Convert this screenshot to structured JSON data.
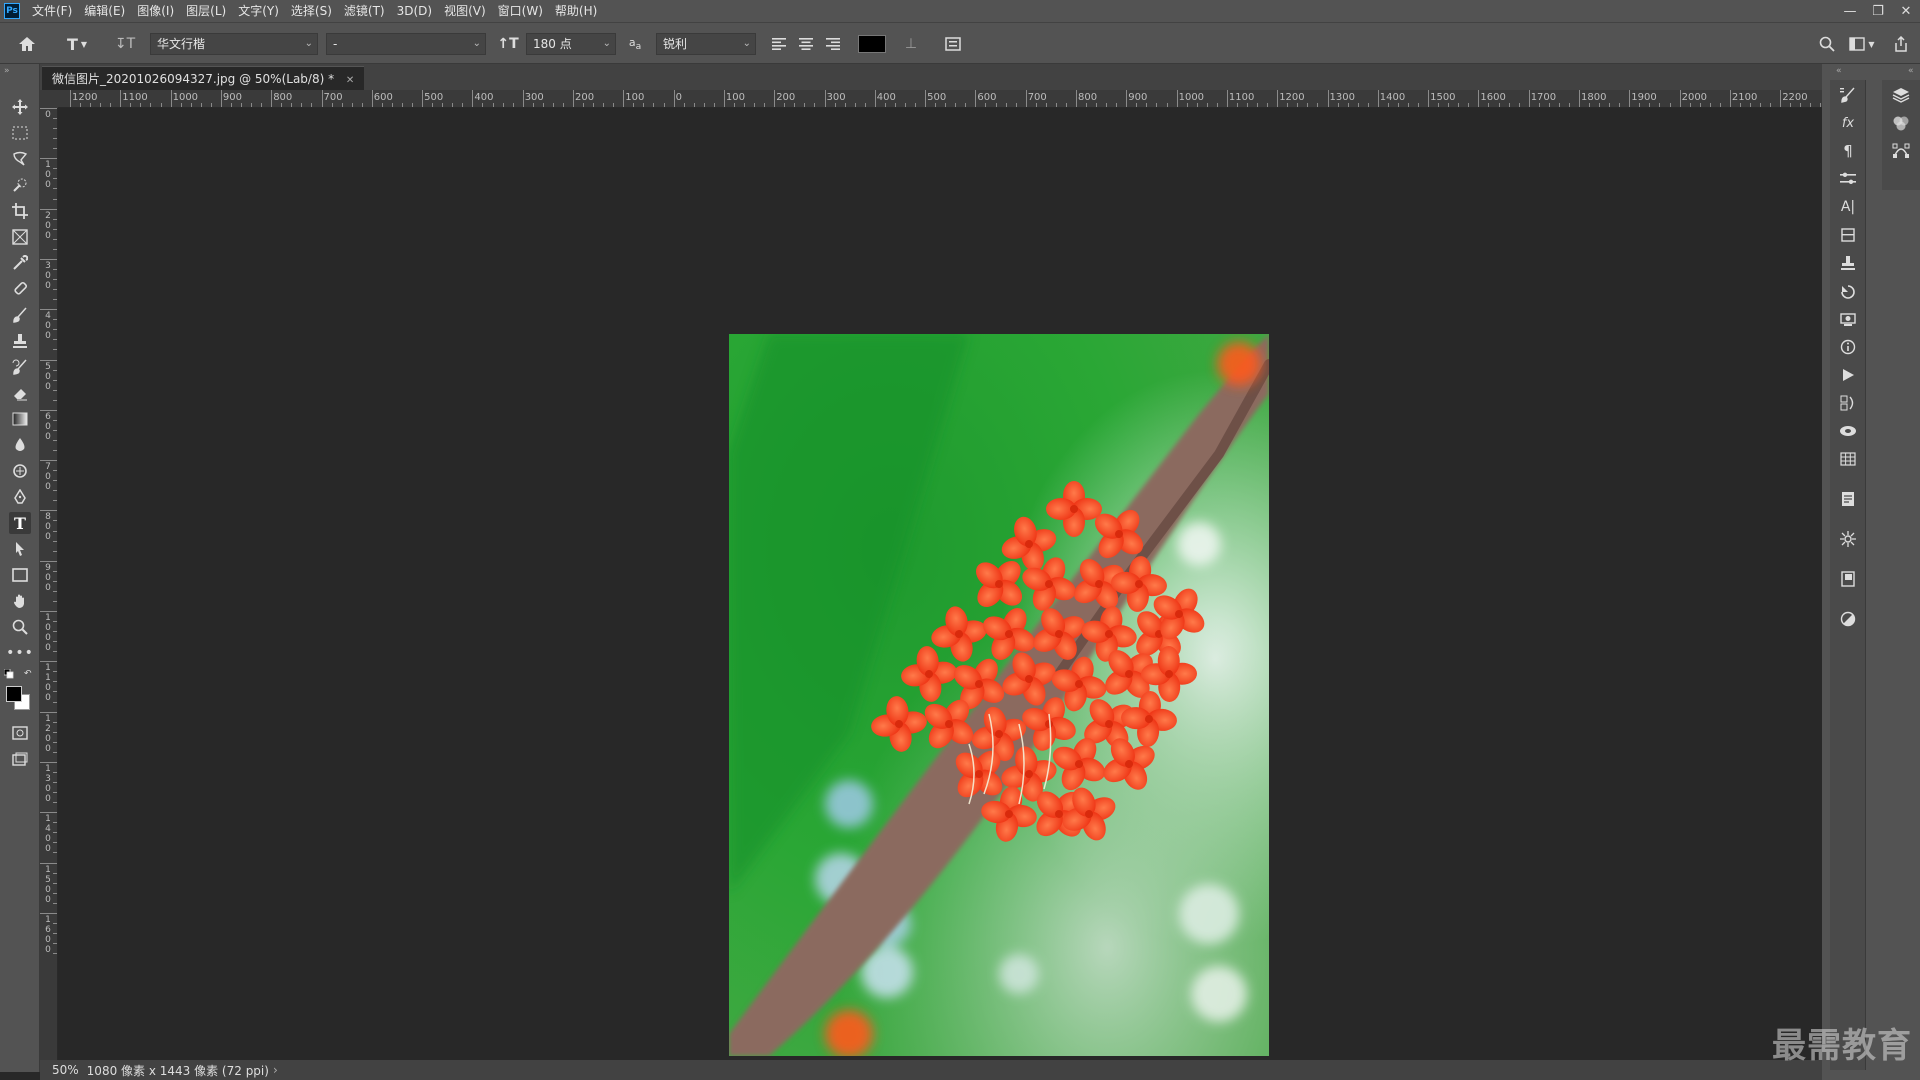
{
  "app": {
    "logo": "Ps"
  },
  "menu": [
    "文件(F)",
    "编辑(E)",
    "图像(I)",
    "图层(L)",
    "文字(Y)",
    "选择(S)",
    "滤镜(T)",
    "3D(D)",
    "视图(V)",
    "窗口(W)",
    "帮助(H)"
  ],
  "options": {
    "font_family": "华文行楷",
    "font_style": "-",
    "font_size": "180 点",
    "antialias": "锐利",
    "text_color": "#000000"
  },
  "document": {
    "tab_title": "微信图片_20201026094327.jpg @ 50%(Lab/8) *"
  },
  "ruler_h_labels": [
    "1200",
    "1100",
    "1000",
    "900",
    "800",
    "700",
    "600",
    "500",
    "400",
    "300",
    "200",
    "100",
    "0",
    "100",
    "200",
    "300",
    "400",
    "500",
    "600",
    "700",
    "800",
    "900",
    "1000",
    "1100",
    "1200",
    "1300",
    "1400",
    "1500",
    "1600",
    "1700",
    "1800",
    "1900",
    "2000",
    "2100",
    "2200"
  ],
  "ruler_v_labels": [
    "0",
    "100",
    "200",
    "300",
    "400",
    "500",
    "600",
    "700",
    "800",
    "900",
    "1000",
    "1100",
    "1200",
    "1300",
    "1400",
    "1500",
    "1600"
  ],
  "status": {
    "zoom": "50%",
    "info": "1080 像素 x 1443 像素 (72 ppi)"
  },
  "watermark": "最需教育"
}
